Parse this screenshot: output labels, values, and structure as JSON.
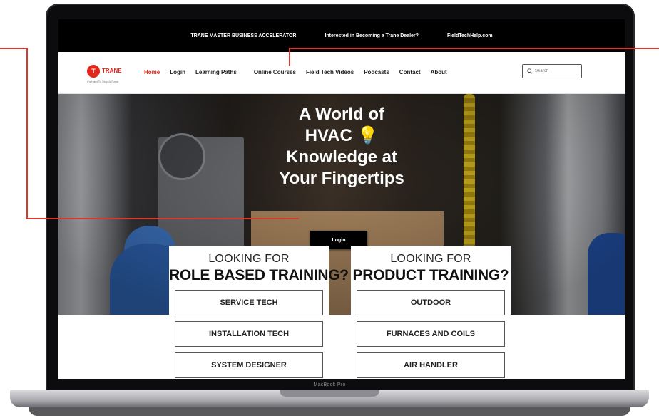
{
  "topbar": {
    "links": [
      "TRANE MASTER BUSINESS ACCELERATOR",
      "Interested in Becoming a Trane Dealer?",
      "FieldTechHelp.com"
    ]
  },
  "logo": {
    "mark": "T",
    "word": "TRANE",
    "tagline": "It's Hard To Stop A Trane."
  },
  "nav": {
    "items": [
      "Home",
      "Login",
      "Learning Paths",
      "Online Courses",
      "Field Tech Videos",
      "Podcasts",
      "Contact",
      "About"
    ],
    "active": "Home"
  },
  "search": {
    "placeholder": "Search"
  },
  "hero": {
    "lines": [
      "A World of",
      "HVAC 💡",
      "Knowledge at",
      "Your Fingertips"
    ],
    "button": "Login"
  },
  "cards": [
    {
      "kicker": "LOOKING FOR",
      "heading": "ROLE BASED TRAINING?",
      "options": [
        "SERVICE TECH",
        "INSTALLATION TECH",
        "SYSTEM DESIGNER"
      ]
    },
    {
      "kicker": "LOOKING FOR",
      "heading": "PRODUCT TRAINING?",
      "options": [
        "OUTDOOR",
        "FURNACES AND COILS",
        "AIR HANDLER"
      ]
    }
  ],
  "device": {
    "label": "MacBook Pro"
  },
  "colors": {
    "accent": "#e1261c",
    "callout": "#d8392b"
  }
}
